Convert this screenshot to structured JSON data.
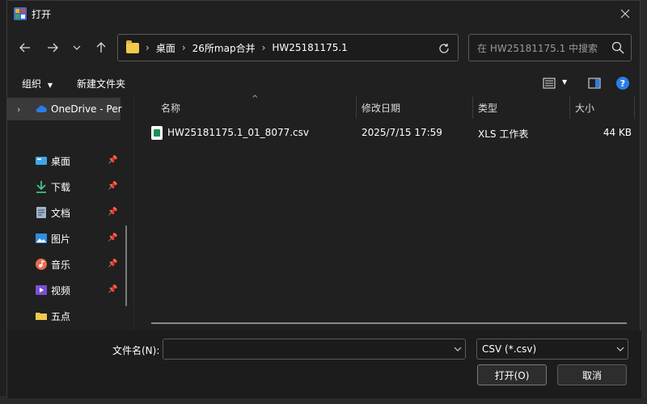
{
  "window": {
    "title": "打开"
  },
  "navigation": {
    "breadcrumbs": [
      "桌面",
      "26所map合并",
      "HW25181175.1"
    ],
    "search_placeholder": "在 HW25181175.1 中搜索"
  },
  "commands": {
    "organize": "组织",
    "new_folder": "新建文件夹"
  },
  "sidebar": {
    "items": [
      {
        "label": "OneDrive - Per",
        "icon": "cloud-icon",
        "pinned": false,
        "selected": true
      },
      {
        "label": "桌面",
        "icon": "desktop-icon",
        "pinned": true
      },
      {
        "label": "下载",
        "icon": "download-icon",
        "pinned": true
      },
      {
        "label": "文档",
        "icon": "document-icon",
        "pinned": true
      },
      {
        "label": "图片",
        "icon": "picture-icon",
        "pinned": true
      },
      {
        "label": "音乐",
        "icon": "music-icon",
        "pinned": true
      },
      {
        "label": "视频",
        "icon": "video-icon",
        "pinned": true
      },
      {
        "label": "五点",
        "icon": "folder-icon",
        "pinned": false
      }
    ]
  },
  "columns": {
    "name": "名称",
    "date": "修改日期",
    "type": "类型",
    "size": "大小"
  },
  "files": [
    {
      "name": "HW25181175.1_01_8077.csv",
      "date": "2025/7/15 17:59",
      "type": "XLS 工作表",
      "size": "44 KB"
    }
  ],
  "footer": {
    "filename_label": "文件名(N):",
    "filename_value": "",
    "filetype_value": "CSV (*.csv)",
    "open_label": "打开(O)",
    "cancel_label": "取消"
  },
  "colors": {
    "accent": "#2b7de9",
    "folder": "#f2c94c",
    "csv": "#1e8e5b"
  }
}
